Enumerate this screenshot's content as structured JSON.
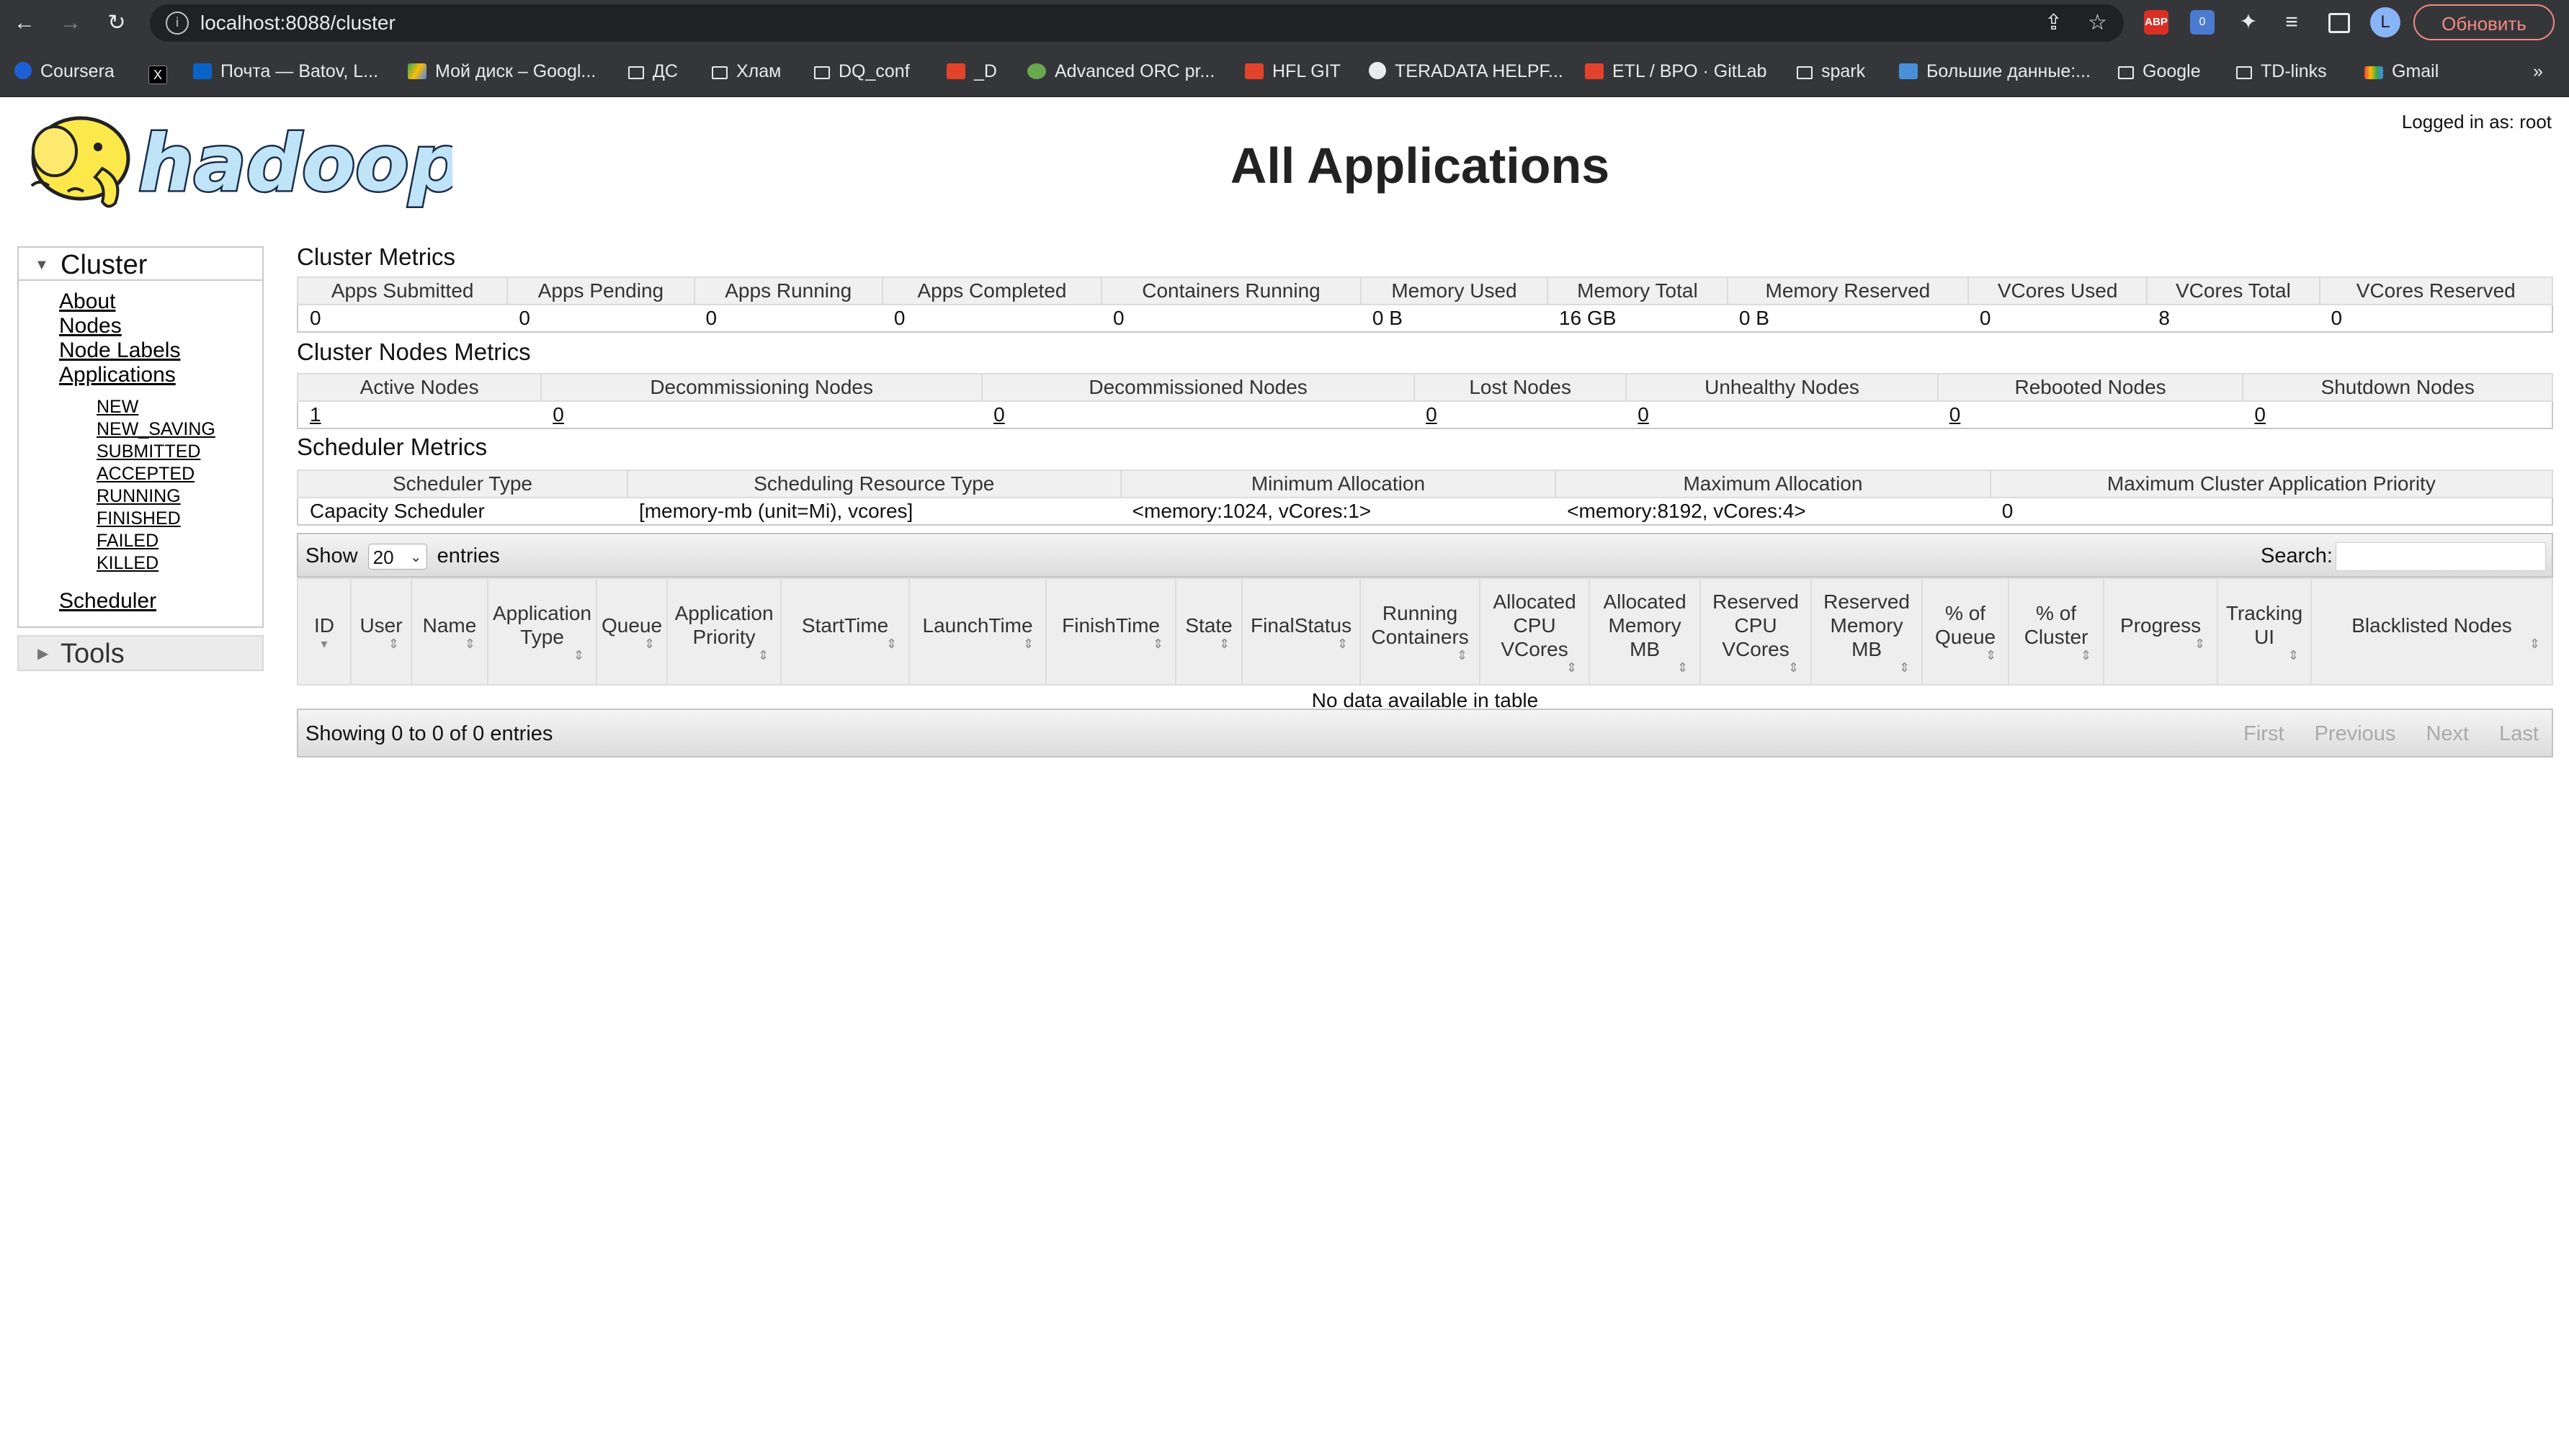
{
  "browser": {
    "url": "localhost:8088/cluster",
    "update_label": "Обновить",
    "avatar_letter": "L",
    "extension_badge": "0",
    "abp_label": "ABP",
    "bookmarks": [
      "Coursera",
      "",
      "Почта — Batov, L...",
      "Мой диск – Googl...",
      "ДС",
      "Хлам",
      "DQ_conf",
      "_D",
      "Advanced ORC pr...",
      "HFL GIT",
      "TERADATA HELPF...",
      "ETL / BPO · GitLab",
      "spark",
      "Большие данные:...",
      "Google",
      "TD-links",
      "Gmail"
    ],
    "more": "»"
  },
  "header": {
    "title": "All Applications",
    "logged_in": "Logged in as: root",
    "logo_text": "hadoop"
  },
  "sidebar": {
    "cluster_label": "Cluster",
    "links": [
      "About",
      "Nodes",
      "Node Labels",
      "Applications"
    ],
    "app_states": [
      "NEW",
      "NEW_SAVING",
      "SUBMITTED",
      "ACCEPTED",
      "RUNNING",
      "FINISHED",
      "FAILED",
      "KILLED"
    ],
    "scheduler": "Scheduler",
    "tools_label": "Tools"
  },
  "cluster_metrics": {
    "title": "Cluster Metrics",
    "headers": [
      "Apps Submitted",
      "Apps Pending",
      "Apps Running",
      "Apps Completed",
      "Containers Running",
      "Memory Used",
      "Memory Total",
      "Memory Reserved",
      "VCores Used",
      "VCores Total",
      "VCores Reserved"
    ],
    "values": [
      "0",
      "0",
      "0",
      "0",
      "0",
      "0 B",
      "16 GB",
      "0 B",
      "0",
      "8",
      "0"
    ]
  },
  "nodes_metrics": {
    "title": "Cluster Nodes Metrics",
    "headers": [
      "Active Nodes",
      "Decommissioning Nodes",
      "Decommissioned Nodes",
      "Lost Nodes",
      "Unhealthy Nodes",
      "Rebooted Nodes",
      "Shutdown Nodes"
    ],
    "values": [
      "1",
      "0",
      "0",
      "0",
      "0",
      "0",
      "0"
    ]
  },
  "scheduler_metrics": {
    "title": "Scheduler Metrics",
    "headers": [
      "Scheduler Type",
      "Scheduling Resource Type",
      "Minimum Allocation",
      "Maximum Allocation",
      "Maximum Cluster Application Priority"
    ],
    "values": [
      "Capacity Scheduler",
      "[memory-mb (unit=Mi), vcores]",
      "<memory:1024, vCores:1>",
      "<memory:8192, vCores:4>",
      "0"
    ]
  },
  "apps_table": {
    "show_label": "Show",
    "entries_label": "entries",
    "page_size": "20",
    "search_label": "Search:",
    "columns": [
      "ID",
      "User",
      "Name",
      "Application Type",
      "Queue",
      "Application Priority",
      "StartTime",
      "LaunchTime",
      "FinishTime",
      "State",
      "FinalStatus",
      "Running Containers",
      "Allocated CPU VCores",
      "Allocated Memory MB",
      "Reserved CPU VCores",
      "Reserved Memory MB",
      "% of Queue",
      "% of Cluster",
      "Progress",
      "Tracking UI",
      "Blacklisted Nodes"
    ],
    "empty_message": "No data available in table",
    "showing": "Showing 0 to 0 of 0 entries",
    "pager": [
      "First",
      "Previous",
      "Next",
      "Last"
    ]
  }
}
